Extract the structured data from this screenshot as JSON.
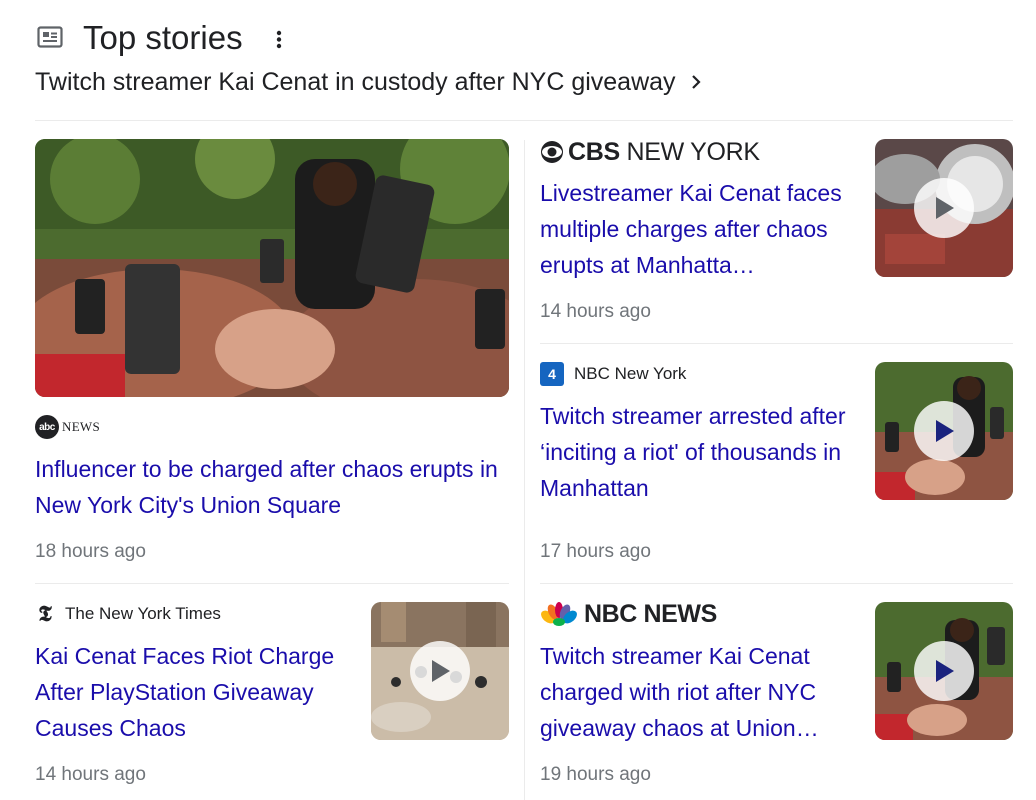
{
  "header": {
    "icon": "newspaper-icon",
    "title": "Top stories",
    "menu_icon": "more-vert-icon",
    "headline": "Twitch streamer Kai Cenat in custody after NYC giveaway",
    "headline_icon": "chevron-right-icon"
  },
  "cards": [
    {
      "source": "abc NEWS",
      "title": "Influencer to be charged after chaos erupts in New York City's Union Square",
      "time": "18 hours ago"
    },
    {
      "source": "CBS NEW YORK",
      "title": "Livestreamer Kai Cenat faces multiple charges after chaos erupts at Manhatta…",
      "time": "14 hours ago",
      "video": true
    },
    {
      "source": "NBC New York",
      "title": "Twitch streamer arrested after ‘inciting a riot' of thousands in Manhattan",
      "time": "17 hours ago",
      "video": true
    },
    {
      "source": "The New York Times",
      "title": "Kai Cenat Faces Riot Charge After PlayStation Giveaway Causes Chaos",
      "time": "14 hours ago",
      "video": true
    },
    {
      "source": "NBC NEWS",
      "title": "Twitch streamer Kai Cenat charged with riot after NYC giveaway chaos at Union…",
      "time": "19 hours ago",
      "video": true
    }
  ],
  "colors": {
    "link": "#1a0dab",
    "text": "#202124",
    "muted": "#70757a",
    "divider": "#ebebeb"
  }
}
